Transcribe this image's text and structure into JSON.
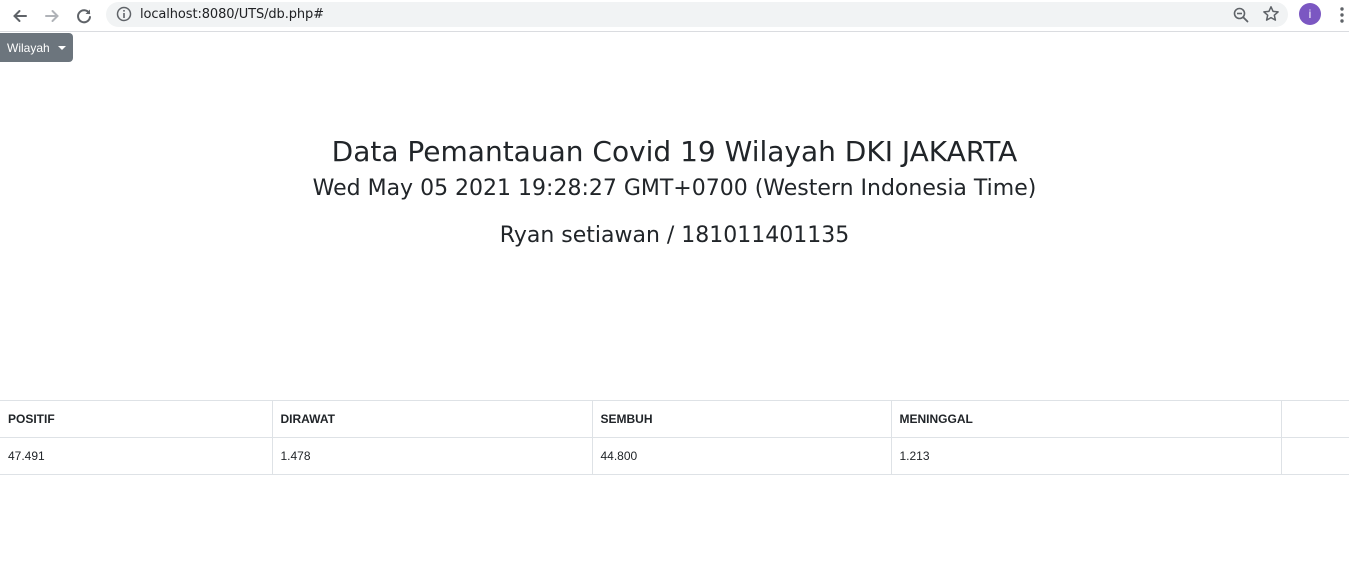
{
  "browser": {
    "url": "localhost:8080/UTS/db.php#",
    "profile_initial": "i"
  },
  "dropdown": {
    "label": "Wilayah"
  },
  "header": {
    "title": "Data Pemantauan Covid 19 Wilayah DKI JAKARTA",
    "datetime": "Wed May 05 2021 19:28:27 GMT+0700 (Western Indonesia Time)",
    "author": "Ryan setiawan / 181011401135"
  },
  "table": {
    "headers": [
      "POSITIF",
      "DIRAWAT",
      "SEMBUH",
      "MENINGGAL"
    ],
    "rows": [
      [
        "47.491",
        "1.478",
        "44.800",
        "1.213"
      ]
    ]
  },
  "colors": {
    "dropdown_bg": "#6c757d",
    "avatar_bg": "#7b57c2",
    "table_border": "#dee2e6"
  }
}
